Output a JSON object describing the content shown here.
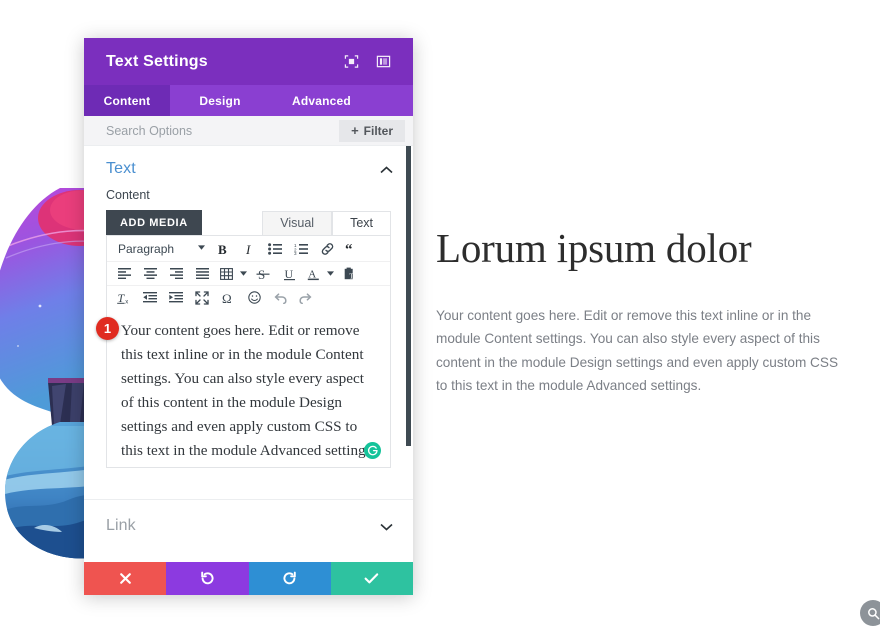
{
  "panel": {
    "title": "Text Settings",
    "header_icons": [
      {
        "name": "focus-mode-icon",
        "label": "Focus mode"
      },
      {
        "name": "panel-layout-icon",
        "label": "Panel layout"
      }
    ],
    "tabs": [
      {
        "label": "Content",
        "active": true
      },
      {
        "label": "Design",
        "active": false
      },
      {
        "label": "Advanced",
        "active": false
      }
    ],
    "search": {
      "placeholder": "Search Options",
      "value": ""
    },
    "filter_button": {
      "label": "Filter",
      "plus": "+"
    },
    "sections": {
      "text": {
        "title": "Text",
        "collapsed": false,
        "chevron": "⌃",
        "content_label": "Content",
        "add_media_label": "ADD MEDIA",
        "editor_tabs": [
          {
            "label": "Visual",
            "active": false
          },
          {
            "label": "Text",
            "active": true
          }
        ],
        "toolbar_row1": [
          {
            "name": "paragraph-format-select",
            "label": "Paragraph"
          },
          {
            "name": "bold-icon",
            "label": "B"
          },
          {
            "name": "italic-icon",
            "label": "I"
          },
          {
            "name": "bulleted-list-icon",
            "label": "Bulleted list"
          },
          {
            "name": "numbered-list-icon",
            "label": "Numbered list"
          },
          {
            "name": "insert-link-icon",
            "label": "Insert link"
          },
          {
            "name": "blockquote-icon",
            "label": "Blockquote"
          }
        ],
        "toolbar_row2": [
          {
            "name": "align-left-icon",
            "label": "Align left"
          },
          {
            "name": "align-center-icon",
            "label": "Align center"
          },
          {
            "name": "align-right-icon",
            "label": "Align right"
          },
          {
            "name": "align-justify-icon",
            "label": "Justify"
          },
          {
            "name": "table-icon",
            "label": "Table"
          },
          {
            "name": "strikethrough-icon",
            "label": "Strikethrough"
          },
          {
            "name": "underline-icon",
            "label": "Underline"
          },
          {
            "name": "text-color-icon",
            "label": "Text color"
          },
          {
            "name": "paste-as-text-icon",
            "label": "Paste as text"
          }
        ],
        "toolbar_row3": [
          {
            "name": "clear-formatting-icon",
            "label": "Clear formatting"
          },
          {
            "name": "outdent-icon",
            "label": "Decrease indent"
          },
          {
            "name": "indent-icon",
            "label": "Increase indent"
          },
          {
            "name": "fullscreen-icon",
            "label": "Fullscreen"
          },
          {
            "name": "special-character-icon",
            "label": "Ω"
          },
          {
            "name": "emoji-icon",
            "label": "Emoji"
          },
          {
            "name": "undo-icon",
            "label": "Undo"
          },
          {
            "name": "redo-icon",
            "label": "Redo"
          }
        ],
        "editor_value": "Your content goes here. Edit or remove this text inline or in the module Content settings. You can also style every aspect of this content in the module Design settings and even apply custom CSS to this text in the module Advanced settings.",
        "grammarly_icon": "G"
      },
      "link": {
        "title": "Link",
        "collapsed": true,
        "chevron": "⌄"
      }
    },
    "footer_buttons": [
      {
        "name": "cancel-button",
        "glyph": "✖",
        "color": "#ef5450"
      },
      {
        "name": "undo-button",
        "glyph": "↺",
        "color": "#8c3ae0"
      },
      {
        "name": "redo-button",
        "glyph": "↻",
        "color": "#2e8fd4"
      },
      {
        "name": "save-button",
        "glyph": "✔",
        "color": "#2ec2a0"
      }
    ]
  },
  "step_badge": {
    "number": "1"
  },
  "content": {
    "heading": "Lorum ipsum dolor",
    "paragraph": "Your content goes here. Edit or remove this text inline or in the module Content settings. You can also style every aspect of this content in the module Design settings and even apply custom CSS to this text in the module Advanced settings."
  },
  "colors": {
    "panel_header": "#7b2fbe",
    "tabbar": "#8a3fd1",
    "active_tab": "#6e2bb5",
    "accent_link": "#4a8fd0",
    "badge_red": "#e02b20",
    "grammarly_green": "#15c39a"
  }
}
